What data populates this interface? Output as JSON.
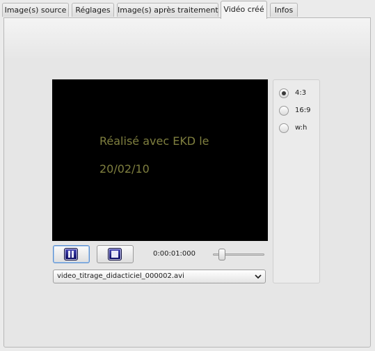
{
  "tabs": [
    {
      "label": "Image(s) source",
      "active": false
    },
    {
      "label": "Réglages",
      "active": false
    },
    {
      "label": "Image(s) après traitement",
      "active": false
    },
    {
      "label": "Vidéo créé",
      "active": true
    },
    {
      "label": "Infos",
      "active": false
    }
  ],
  "video": {
    "line1": "Réalisé avec EKD le",
    "line2": "20/02/10"
  },
  "player": {
    "time": "0:00:01:000",
    "position_fraction": 0.18
  },
  "file_select": {
    "selected": "video_titrage_didacticiel_000002.avi"
  },
  "ratio": {
    "options": [
      {
        "label": "4:3",
        "checked": true
      },
      {
        "label": "16:9",
        "checked": false
      },
      {
        "label": "w:h",
        "checked": false
      }
    ]
  }
}
